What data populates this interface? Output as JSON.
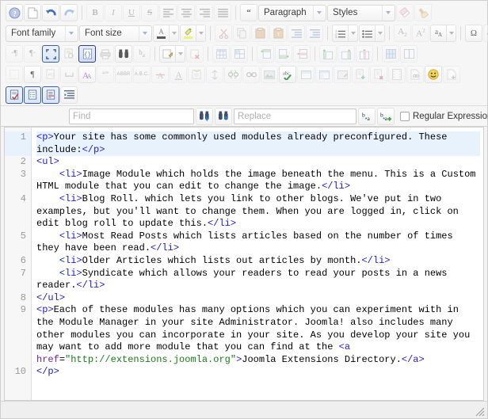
{
  "app": {
    "name": "JCE Editor — Source Code View",
    "accent": "#2b3f86"
  },
  "toolbars": {
    "row1": [
      {
        "name": "help-icon",
        "label": "Help"
      },
      {
        "name": "new-document-icon",
        "label": "New Document"
      },
      {
        "name": "undo-icon",
        "label": "Undo"
      },
      {
        "name": "redo-icon",
        "label": "Redo"
      },
      {
        "name": "bold-icon",
        "label": "B"
      },
      {
        "name": "italic-icon",
        "label": "I"
      },
      {
        "name": "underline-icon",
        "label": "U"
      },
      {
        "name": "strikethrough-icon",
        "label": "S"
      },
      {
        "name": "align-left-icon",
        "label": "Align Left"
      },
      {
        "name": "align-center-icon",
        "label": "Align Center"
      },
      {
        "name": "align-right-icon",
        "label": "Align Right"
      },
      {
        "name": "align-justify-icon",
        "label": "Justify"
      },
      {
        "name": "blockquote-icon",
        "label": "Blockquote"
      },
      {
        "name": "eraser-icon",
        "label": "Remove Format"
      },
      {
        "name": "cleanup-icon",
        "label": "Cleanup Code"
      }
    ],
    "paragraph_select": {
      "value": "Paragraph"
    },
    "styles_select": {
      "value": "Styles"
    },
    "fontfamily_select": {
      "value": "Font family"
    },
    "fontsize_select": {
      "value": "Font size"
    },
    "row2": [
      {
        "name": "forecolor-icon",
        "label": "Text Color"
      },
      {
        "name": "backcolor-icon",
        "label": "Background Color"
      },
      {
        "name": "cut-icon",
        "label": "Cut"
      },
      {
        "name": "copy-icon",
        "label": "Copy"
      },
      {
        "name": "paste-icon",
        "label": "Paste"
      },
      {
        "name": "paste-text-icon",
        "label": "Paste as Text"
      },
      {
        "name": "outdent-icon",
        "label": "Outdent"
      },
      {
        "name": "indent-icon",
        "label": "Indent"
      },
      {
        "name": "numbered-list-icon",
        "label": "Numbered List"
      },
      {
        "name": "bulleted-list-icon",
        "label": "Bulleted List"
      },
      {
        "name": "subscript-icon",
        "label": "Subscript"
      },
      {
        "name": "superscript-icon",
        "label": "Superscript"
      },
      {
        "name": "anchor-icon",
        "label": "Anchor"
      },
      {
        "name": "special-character-icon",
        "label": "Special Character"
      },
      {
        "name": "horizontal-rule-icon",
        "label": "Horizontal Rule"
      }
    ],
    "row3": [
      {
        "name": "show-blocks-icon",
        "label": "Show Blocks"
      },
      {
        "name": "paragraph-mark-icon",
        "label": "Paragraph Mark"
      },
      {
        "name": "preview-icon",
        "label": "Preview"
      },
      {
        "name": "source-code-icon",
        "label": "Source Code",
        "active": true
      },
      {
        "name": "print-icon",
        "label": "Print"
      },
      {
        "name": "search-icon",
        "label": "Search"
      },
      {
        "name": "replace-icon",
        "label": "Replace"
      },
      {
        "name": "edit-icon",
        "label": "Edit"
      },
      {
        "name": "remove-icon",
        "label": "Remove"
      },
      {
        "name": "table-icon",
        "label": "Insert Table"
      },
      {
        "name": "table-properties-icon",
        "label": "Table Properties"
      },
      {
        "name": "row-insert-before-icon",
        "label": "Insert Row Before"
      },
      {
        "name": "row-insert-after-icon",
        "label": "Insert Row After"
      },
      {
        "name": "row-delete-icon",
        "label": "Delete Row"
      },
      {
        "name": "column-insert-before-icon",
        "label": "Insert Column Before"
      },
      {
        "name": "column-insert-after-icon",
        "label": "Insert Column After"
      },
      {
        "name": "column-delete-icon",
        "label": "Delete Column"
      },
      {
        "name": "merge-cells-icon",
        "label": "Merge Cells"
      },
      {
        "name": "split-cells-icon",
        "label": "Split Cells"
      },
      {
        "name": "fullscreen-icon",
        "label": "Fullscreen"
      }
    ],
    "row4": [
      {
        "name": "grid-icon",
        "label": "Grid"
      },
      {
        "name": "pilcrow-icon",
        "label": "Pilcrow"
      },
      {
        "name": "page-break-icon",
        "label": "Page Break"
      },
      {
        "name": "nonbreaking-space-icon",
        "label": "Non-breaking Space"
      },
      {
        "name": "font-style-icon",
        "label": "Font Style"
      },
      {
        "name": "quote-icon",
        "label": "Quote"
      },
      {
        "name": "abbreviation-icon",
        "label": "ABBR"
      },
      {
        "name": "acronym-icon",
        "label": "A.B.C."
      },
      {
        "name": "delete-text-icon",
        "label": "Delete Text"
      },
      {
        "name": "insert-text-icon",
        "label": "Insert Text"
      },
      {
        "name": "citation-icon",
        "label": "Citation"
      },
      {
        "name": "attribute-icon",
        "label": "Attributes"
      },
      {
        "name": "unlink-icon",
        "label": "Unlink"
      },
      {
        "name": "link-icon",
        "label": "Link"
      },
      {
        "name": "image-icon",
        "label": "Insert Image"
      },
      {
        "name": "spellcheck-icon",
        "label": "Spellcheck"
      },
      {
        "name": "iframe-icon",
        "label": "Insert IFrame"
      },
      {
        "name": "layers-icon",
        "label": "Layers"
      },
      {
        "name": "media-icon",
        "label": "Insert Media"
      },
      {
        "name": "article-add-icon",
        "label": "Add Article"
      },
      {
        "name": "article-delete-icon",
        "label": "Delete Article"
      },
      {
        "name": "filmstrip-icon",
        "label": "Film"
      },
      {
        "name": "document-link-icon",
        "label": "Document Link"
      },
      {
        "name": "emoticon-icon",
        "label": "Emoticon"
      },
      {
        "name": "template-icon",
        "label": "Insert Template"
      }
    ],
    "row5": [
      {
        "name": "validate-icon",
        "label": "Validate",
        "active": true
      },
      {
        "name": "source-format-icon",
        "label": "Format Source",
        "active": true
      },
      {
        "name": "source-compress-icon",
        "label": "Compress Source",
        "active": true
      },
      {
        "name": "auto-indent-icon",
        "label": "Auto Indent"
      }
    ]
  },
  "findbar": {
    "find_placeholder": "Find",
    "find_value": "",
    "replace_placeholder": "Replace",
    "replace_value": "",
    "find_next_icon": "find-next-icon",
    "find_prev_icon": "find-previous-icon",
    "replace_one_icon": "replace-one-icon",
    "replace_all_icon": "replace-all-icon",
    "regex_label": "Regular Expression",
    "regex_checked": false
  },
  "code_editor": {
    "highlighted_line": 1,
    "line_numbers": [
      "1",
      "2",
      "3",
      "4",
      "5",
      "6",
      "7",
      "8",
      "9",
      "10"
    ],
    "lines": [
      {
        "n": "1",
        "text": "<p>Your site has some commonly used modules already preconfigured. These include:</p>"
      },
      {
        "n": "2",
        "text": "<ul>"
      },
      {
        "n": "3",
        "text": "    <li>Image Module which holds the image beneath the menu. This is a Custom HTML module that you can edit to change the image.</li>"
      },
      {
        "n": "4",
        "text": "    <li>Blog Roll. which lets you link to other blogs. We've put in two examples, but you'll want to change them. When you are logged in, click on edit blog roll to update this.</li>"
      },
      {
        "n": "5",
        "text": "    <li>Most Read Posts which lists articles based on the number of times they have been read.</li>"
      },
      {
        "n": "6",
        "text": "    <li>Older Articles which lists out articles by month.</li>"
      },
      {
        "n": "7",
        "text": "    <li>Syndicate which allows your readers to read your posts in a news reader.</li>"
      },
      {
        "n": "8",
        "text": "</ul>"
      },
      {
        "n": "9",
        "text": "<p>Each of these modules has many options which you can experiment with in the Module Manager in your site Administrator. Joomla! also includes many other modules you can incorporate in your site. As you develop your site you may want to add more module that you can find at the <a href=\"http://extensions.joomla.org\">Joomla Extensions Directory.</a>"
      },
      {
        "n": "10",
        "text": "</p>"
      }
    ],
    "link_url": "http://extensions.joomla.org",
    "link_text": "Joomla Extensions Directory."
  },
  "statusbar": {
    "resize_grip_icon": "resize-grip-icon"
  }
}
